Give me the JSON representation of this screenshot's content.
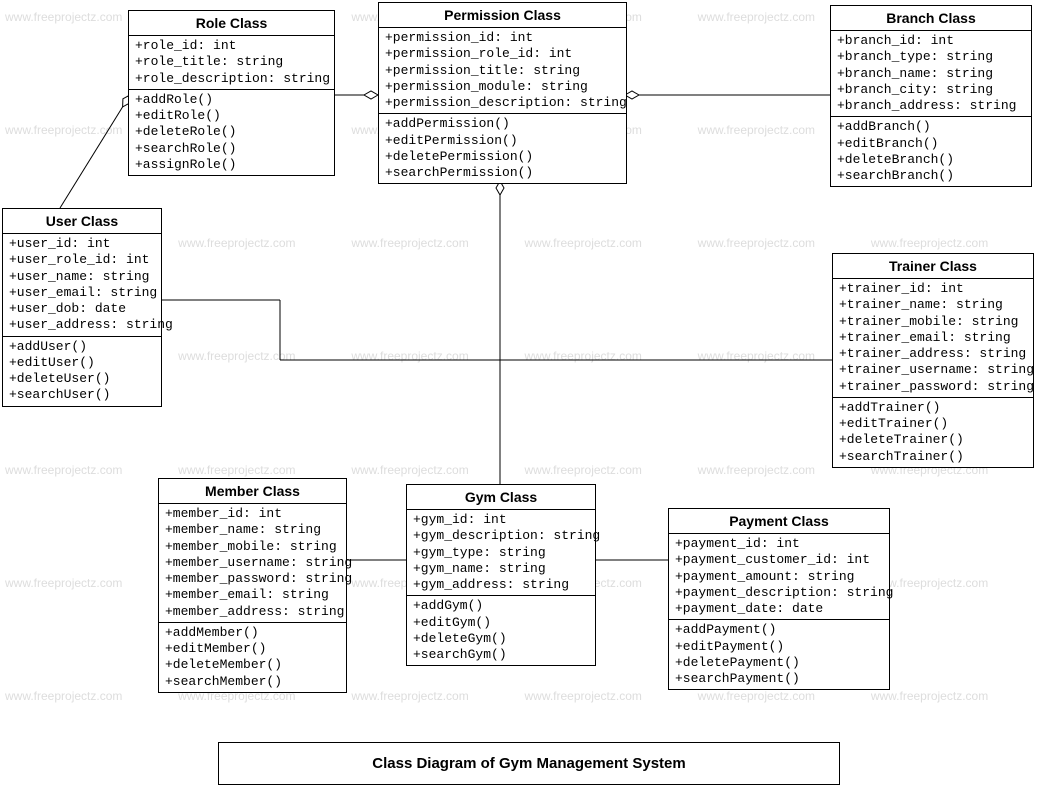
{
  "diagram_title": "Class Diagram of Gym Management System",
  "watermark_text": "www.freeprojectz.com",
  "classes": {
    "role": {
      "name": "Role Class",
      "attributes": [
        "+role_id: int",
        "+role_title: string",
        "+role_description: string"
      ],
      "methods": [
        "+addRole()",
        "+editRole()",
        "+deleteRole()",
        "+searchRole()",
        "+assignRole()"
      ]
    },
    "permission": {
      "name": "Permission Class",
      "attributes": [
        "+permission_id: int",
        "+permission_role_id: int",
        "+permission_title: string",
        "+permission_module: string",
        "+permission_description: string"
      ],
      "methods": [
        "+addPermission()",
        "+editPermission()",
        "+deletePermission()",
        "+searchPermission()"
      ]
    },
    "branch": {
      "name": "Branch Class",
      "attributes": [
        "+branch_id: int",
        "+branch_type: string",
        "+branch_name: string",
        "+branch_city: string",
        "+branch_address: string"
      ],
      "methods": [
        "+addBranch()",
        "+editBranch()",
        "+deleteBranch()",
        "+searchBranch()"
      ]
    },
    "user": {
      "name": "User Class",
      "attributes": [
        "+user_id: int",
        "+user_role_id: int",
        "+user_name: string",
        "+user_email: string",
        "+user_dob: date",
        "+user_address: string"
      ],
      "methods": [
        "+addUser()",
        "+editUser()",
        "+deleteUser()",
        "+searchUser()"
      ]
    },
    "trainer": {
      "name": "Trainer Class",
      "attributes": [
        "+trainer_id: int",
        "+trainer_name: string",
        "+trainer_mobile: string",
        "+trainer_email: string",
        "+trainer_address: string",
        "+trainer_username: string",
        "+trainer_password: string"
      ],
      "methods": [
        "+addTrainer()",
        "+editTrainer()",
        "+deleteTrainer()",
        "+searchTrainer()"
      ]
    },
    "member": {
      "name": "Member Class",
      "attributes": [
        "+member_id: int",
        "+member_name: string",
        "+member_mobile: string",
        "+member_username: string",
        "+member_password: string",
        "+member_email: string",
        "+member_address: string"
      ],
      "methods": [
        "+addMember()",
        "+editMember()",
        "+deleteMember()",
        "+searchMember()"
      ]
    },
    "gym": {
      "name": "Gym Class",
      "attributes": [
        "+gym_id: int",
        "+gym_description: string",
        "+gym_type: string",
        "+gym_name: string",
        "+gym_address: string"
      ],
      "methods": [
        "+addGym()",
        "+editGym()",
        "+deleteGym()",
        "+searchGym()"
      ]
    },
    "payment": {
      "name": "Payment Class",
      "attributes": [
        "+payment_id: int",
        "+payment_customer_id: int",
        "+payment_amount: string",
        "+payment_description: string",
        "+payment_date: date"
      ],
      "methods": [
        "+addPayment()",
        "+editPayment()",
        "+deletePayment()",
        "+searchPayment()"
      ]
    }
  }
}
